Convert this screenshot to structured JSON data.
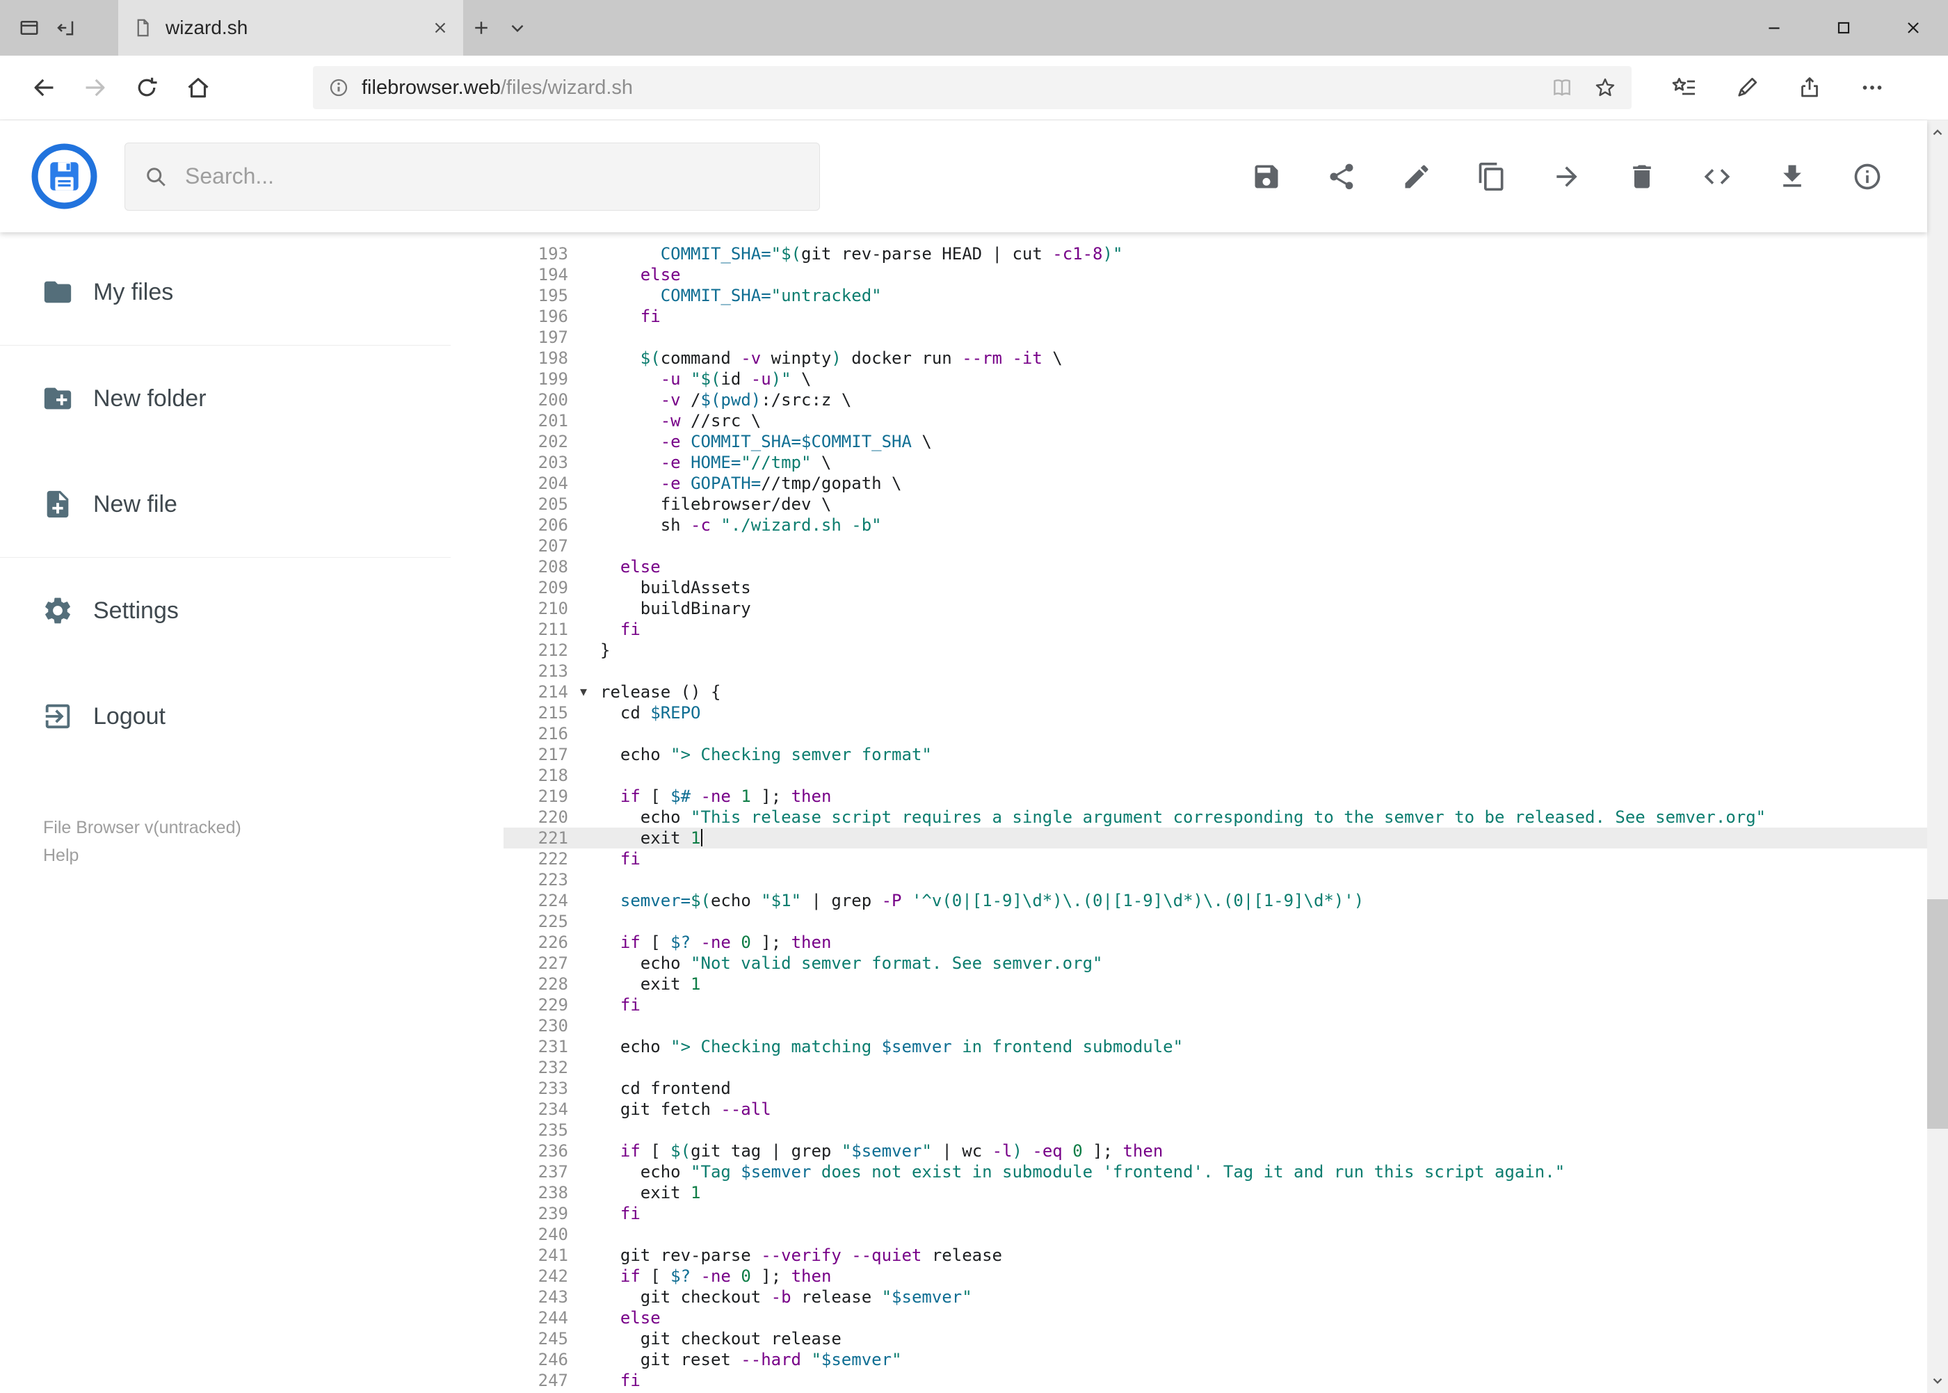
{
  "window": {
    "tab": {
      "title": "wizard.sh"
    },
    "controls": [
      "minimize",
      "maximize",
      "close"
    ]
  },
  "browser": {
    "url": {
      "domain": "filebrowser.web",
      "path": "/files/wizard.sh"
    },
    "nav_icons": [
      "back",
      "forward",
      "refresh",
      "home"
    ],
    "right_icons": [
      "reading-view",
      "favorite-star",
      "favorites-hub",
      "web-note",
      "share",
      "more"
    ]
  },
  "app": {
    "search": {
      "placeholder": "Search..."
    },
    "toolbar_icons": [
      "save",
      "share",
      "rename",
      "copy",
      "move",
      "delete",
      "code",
      "download",
      "info"
    ],
    "sidebar": {
      "items": [
        {
          "label": "My files",
          "icon": "folder"
        },
        {
          "label": "New folder",
          "icon": "new-folder"
        },
        {
          "label": "New file",
          "icon": "new-file"
        },
        {
          "label": "Settings",
          "icon": "settings"
        },
        {
          "label": "Logout",
          "icon": "logout"
        }
      ],
      "version": "File Browser v(untracked)",
      "help": "Help"
    }
  },
  "editor": {
    "active_line": 221,
    "fold_line": 214,
    "fold_glyph": "▾",
    "cursor_on_active": true,
    "lines": [
      {
        "n": 193,
        "t": [
          [
            "p",
            "      "
          ],
          [
            "v",
            "COMMIT_SHA="
          ],
          [
            "s",
            "\"$("
          ],
          [
            "p",
            "git rev-parse HEAD | cut "
          ],
          [
            "k",
            "-c1-8"
          ],
          [
            "s",
            ")\""
          ]
        ]
      },
      {
        "n": 194,
        "t": [
          [
            "p",
            "    "
          ],
          [
            "k",
            "else"
          ]
        ]
      },
      {
        "n": 195,
        "t": [
          [
            "p",
            "      "
          ],
          [
            "v",
            "COMMIT_SHA="
          ],
          [
            "s",
            "\"untracked\""
          ]
        ]
      },
      {
        "n": 196,
        "t": [
          [
            "p",
            "    "
          ],
          [
            "k",
            "fi"
          ]
        ]
      },
      {
        "n": 197,
        "t": []
      },
      {
        "n": 198,
        "t": [
          [
            "p",
            "    "
          ],
          [
            "s",
            "$("
          ],
          [
            "p",
            "command "
          ],
          [
            "k",
            "-v"
          ],
          [
            "p",
            " winpty"
          ],
          [
            "s",
            ")"
          ],
          [
            "p",
            " docker run "
          ],
          [
            "k",
            "--rm"
          ],
          [
            "p",
            " "
          ],
          [
            "k",
            "-it"
          ],
          [
            "p",
            " \\"
          ]
        ]
      },
      {
        "n": 199,
        "t": [
          [
            "p",
            "      "
          ],
          [
            "k",
            "-u"
          ],
          [
            "p",
            " "
          ],
          [
            "s",
            "\"$("
          ],
          [
            "p",
            "id "
          ],
          [
            "k",
            "-u"
          ],
          [
            "s",
            ")\""
          ],
          [
            "p",
            " \\"
          ]
        ]
      },
      {
        "n": 200,
        "t": [
          [
            "p",
            "      "
          ],
          [
            "k",
            "-v"
          ],
          [
            "p",
            " /"
          ],
          [
            "v",
            "$(pwd)"
          ],
          [
            "p",
            ":/src:z \\"
          ]
        ]
      },
      {
        "n": 201,
        "t": [
          [
            "p",
            "      "
          ],
          [
            "k",
            "-w"
          ],
          [
            "p",
            " //src \\"
          ]
        ]
      },
      {
        "n": 202,
        "t": [
          [
            "p",
            "      "
          ],
          [
            "k",
            "-e"
          ],
          [
            "p",
            " "
          ],
          [
            "v",
            "COMMIT_SHA=$COMMIT_SHA"
          ],
          [
            "p",
            " \\"
          ]
        ]
      },
      {
        "n": 203,
        "t": [
          [
            "p",
            "      "
          ],
          [
            "k",
            "-e"
          ],
          [
            "p",
            " "
          ],
          [
            "v",
            "HOME="
          ],
          [
            "s",
            "\"//tmp\""
          ],
          [
            "p",
            " \\"
          ]
        ]
      },
      {
        "n": 204,
        "t": [
          [
            "p",
            "      "
          ],
          [
            "k",
            "-e"
          ],
          [
            "p",
            " "
          ],
          [
            "v",
            "GOPATH="
          ],
          [
            "p",
            "//tmp/gopath \\"
          ]
        ]
      },
      {
        "n": 205,
        "t": [
          [
            "p",
            "      filebrowser/dev \\"
          ]
        ]
      },
      {
        "n": 206,
        "t": [
          [
            "p",
            "      sh "
          ],
          [
            "k",
            "-c"
          ],
          [
            "p",
            " "
          ],
          [
            "s",
            "\"./wizard.sh -b\""
          ]
        ]
      },
      {
        "n": 207,
        "t": []
      },
      {
        "n": 208,
        "t": [
          [
            "p",
            "  "
          ],
          [
            "k",
            "else"
          ]
        ]
      },
      {
        "n": 209,
        "t": [
          [
            "p",
            "    buildAssets"
          ]
        ]
      },
      {
        "n": 210,
        "t": [
          [
            "p",
            "    buildBinary"
          ]
        ]
      },
      {
        "n": 211,
        "t": [
          [
            "p",
            "  "
          ],
          [
            "k",
            "fi"
          ]
        ]
      },
      {
        "n": 212,
        "t": [
          [
            "p",
            "}"
          ]
        ]
      },
      {
        "n": 213,
        "t": []
      },
      {
        "n": 214,
        "t": [
          [
            "p",
            "release () {"
          ]
        ]
      },
      {
        "n": 215,
        "t": [
          [
            "p",
            "  cd "
          ],
          [
            "v",
            "$REPO"
          ]
        ]
      },
      {
        "n": 216,
        "t": []
      },
      {
        "n": 217,
        "t": [
          [
            "p",
            "  echo "
          ],
          [
            "s",
            "\"> Checking semver format\""
          ]
        ]
      },
      {
        "n": 218,
        "t": []
      },
      {
        "n": 219,
        "t": [
          [
            "p",
            "  "
          ],
          [
            "k",
            "if"
          ],
          [
            "p",
            " [ "
          ],
          [
            "v",
            "$#"
          ],
          [
            "p",
            " "
          ],
          [
            "k",
            "-ne"
          ],
          [
            "p",
            " "
          ],
          [
            "n",
            "1"
          ],
          [
            "p",
            " ]; "
          ],
          [
            "k",
            "then"
          ]
        ]
      },
      {
        "n": 220,
        "t": [
          [
            "p",
            "    echo "
          ],
          [
            "s",
            "\"This release script requires a single argument corresponding to the semver to be released. See semver.org\""
          ]
        ]
      },
      {
        "n": 221,
        "t": [
          [
            "p",
            "    exit "
          ],
          [
            "n",
            "1"
          ]
        ]
      },
      {
        "n": 222,
        "t": [
          [
            "p",
            "  "
          ],
          [
            "k",
            "fi"
          ]
        ]
      },
      {
        "n": 223,
        "t": []
      },
      {
        "n": 224,
        "t": [
          [
            "p",
            "  "
          ],
          [
            "v",
            "semver="
          ],
          [
            "s",
            "$("
          ],
          [
            "p",
            "echo "
          ],
          [
            "s",
            "\"$1\""
          ],
          [
            "p",
            " | grep "
          ],
          [
            "k",
            "-P"
          ],
          [
            "p",
            " "
          ],
          [
            "s",
            "'^v(0|[1-9]\\d*)\\.(0|[1-9]\\d*)\\.(0|[1-9]\\d*)'"
          ],
          [
            "s",
            ")"
          ]
        ]
      },
      {
        "n": 225,
        "t": []
      },
      {
        "n": 226,
        "t": [
          [
            "p",
            "  "
          ],
          [
            "k",
            "if"
          ],
          [
            "p",
            " [ "
          ],
          [
            "v",
            "$?"
          ],
          [
            "p",
            " "
          ],
          [
            "k",
            "-ne"
          ],
          [
            "p",
            " "
          ],
          [
            "n",
            "0"
          ],
          [
            "p",
            " ]; "
          ],
          [
            "k",
            "then"
          ]
        ]
      },
      {
        "n": 227,
        "t": [
          [
            "p",
            "    echo "
          ],
          [
            "s",
            "\"Not valid semver format. See semver.org\""
          ]
        ]
      },
      {
        "n": 228,
        "t": [
          [
            "p",
            "    exit "
          ],
          [
            "n",
            "1"
          ]
        ]
      },
      {
        "n": 229,
        "t": [
          [
            "p",
            "  "
          ],
          [
            "k",
            "fi"
          ]
        ]
      },
      {
        "n": 230,
        "t": []
      },
      {
        "n": 231,
        "t": [
          [
            "p",
            "  echo "
          ],
          [
            "s",
            "\"> Checking matching "
          ],
          [
            "v",
            "$semver"
          ],
          [
            "s",
            " in frontend submodule\""
          ]
        ]
      },
      {
        "n": 232,
        "t": []
      },
      {
        "n": 233,
        "t": [
          [
            "p",
            "  cd frontend"
          ]
        ]
      },
      {
        "n": 234,
        "t": [
          [
            "p",
            "  git fetch "
          ],
          [
            "k",
            "--all"
          ]
        ]
      },
      {
        "n": 235,
        "t": []
      },
      {
        "n": 236,
        "t": [
          [
            "p",
            "  "
          ],
          [
            "k",
            "if"
          ],
          [
            "p",
            " [ "
          ],
          [
            "s",
            "$("
          ],
          [
            "p",
            "git tag | grep "
          ],
          [
            "s",
            "\""
          ],
          [
            "v",
            "$semver"
          ],
          [
            "s",
            "\""
          ],
          [
            "p",
            " | wc "
          ],
          [
            "k",
            "-l"
          ],
          [
            "s",
            ")"
          ],
          [
            "p",
            " "
          ],
          [
            "k",
            "-eq"
          ],
          [
            "p",
            " "
          ],
          [
            "n",
            "0"
          ],
          [
            "p",
            " ]; "
          ],
          [
            "k",
            "then"
          ]
        ]
      },
      {
        "n": 237,
        "t": [
          [
            "p",
            "    echo "
          ],
          [
            "s",
            "\"Tag "
          ],
          [
            "v",
            "$semver"
          ],
          [
            "s",
            " does not exist in submodule 'frontend'. Tag it and run this script again.\""
          ]
        ]
      },
      {
        "n": 238,
        "t": [
          [
            "p",
            "    exit "
          ],
          [
            "n",
            "1"
          ]
        ]
      },
      {
        "n": 239,
        "t": [
          [
            "p",
            "  "
          ],
          [
            "k",
            "fi"
          ]
        ]
      },
      {
        "n": 240,
        "t": []
      },
      {
        "n": 241,
        "t": [
          [
            "p",
            "  git rev-parse "
          ],
          [
            "k",
            "--verify"
          ],
          [
            "p",
            " "
          ],
          [
            "k",
            "--quiet"
          ],
          [
            "p",
            " release"
          ]
        ]
      },
      {
        "n": 242,
        "t": [
          [
            "p",
            "  "
          ],
          [
            "k",
            "if"
          ],
          [
            "p",
            " [ "
          ],
          [
            "v",
            "$?"
          ],
          [
            "p",
            " "
          ],
          [
            "k",
            "-ne"
          ],
          [
            "p",
            " "
          ],
          [
            "n",
            "0"
          ],
          [
            "p",
            " ]; "
          ],
          [
            "k",
            "then"
          ]
        ]
      },
      {
        "n": 243,
        "t": [
          [
            "p",
            "    git checkout "
          ],
          [
            "k",
            "-b"
          ],
          [
            "p",
            " release "
          ],
          [
            "s",
            "\""
          ],
          [
            "v",
            "$semver"
          ],
          [
            "s",
            "\""
          ]
        ]
      },
      {
        "n": 244,
        "t": [
          [
            "p",
            "  "
          ],
          [
            "k",
            "else"
          ]
        ]
      },
      {
        "n": 245,
        "t": [
          [
            "p",
            "    git checkout release"
          ]
        ]
      },
      {
        "n": 246,
        "t": [
          [
            "p",
            "    git reset "
          ],
          [
            "k",
            "--hard"
          ],
          [
            "p",
            " "
          ],
          [
            "s",
            "\""
          ],
          [
            "v",
            "$semver"
          ],
          [
            "s",
            "\""
          ]
        ]
      },
      {
        "n": 247,
        "t": [
          [
            "p",
            "  "
          ],
          [
            "k",
            "fi"
          ]
        ]
      }
    ]
  }
}
